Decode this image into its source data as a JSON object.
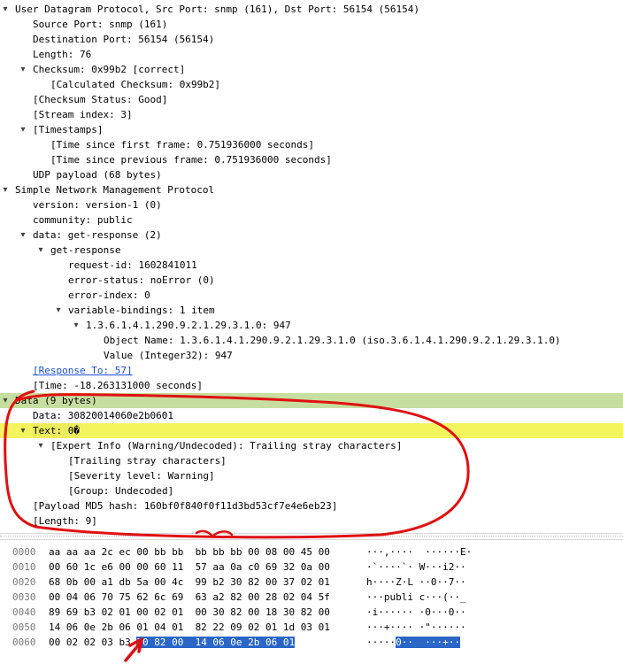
{
  "packet_tree": [
    {
      "indent": 0,
      "arrow": "▾",
      "text": "User Datagram Protocol, Src Port: snmp (161), Dst Port: 56154 (56154)"
    },
    {
      "indent": 1,
      "arrow": "",
      "text": "Source Port: snmp (161)"
    },
    {
      "indent": 1,
      "arrow": "",
      "text": "Destination Port: 56154 (56154)"
    },
    {
      "indent": 1,
      "arrow": "",
      "text": "Length: 76"
    },
    {
      "indent": 1,
      "arrow": "▾",
      "text": "Checksum: 0x99b2 [correct]"
    },
    {
      "indent": 2,
      "arrow": "",
      "text": "[Calculated Checksum: 0x99b2]"
    },
    {
      "indent": 1,
      "arrow": "",
      "text": "[Checksum Status: Good]"
    },
    {
      "indent": 1,
      "arrow": "",
      "text": "[Stream index: 3]"
    },
    {
      "indent": 1,
      "arrow": "▾",
      "text": "[Timestamps]"
    },
    {
      "indent": 2,
      "arrow": "",
      "text": "[Time since first frame: 0.751936000 seconds]"
    },
    {
      "indent": 2,
      "arrow": "",
      "text": "[Time since previous frame: 0.751936000 seconds]"
    },
    {
      "indent": 1,
      "arrow": "",
      "text": "UDP payload (68 bytes)"
    },
    {
      "indent": 0,
      "arrow": "▾",
      "text": "Simple Network Management Protocol"
    },
    {
      "indent": 1,
      "arrow": "",
      "text": "version: version-1 (0)"
    },
    {
      "indent": 1,
      "arrow": "",
      "text": "community: public"
    },
    {
      "indent": 1,
      "arrow": "▾",
      "text": "data: get-response (2)"
    },
    {
      "indent": 2,
      "arrow": "▾",
      "text": "get-response"
    },
    {
      "indent": 3,
      "arrow": "",
      "text": "request-id: 1602841011"
    },
    {
      "indent": 3,
      "arrow": "",
      "text": "error-status: noError (0)"
    },
    {
      "indent": 3,
      "arrow": "",
      "text": "error-index: 0"
    },
    {
      "indent": 3,
      "arrow": "▾",
      "text": "variable-bindings: 1 item"
    },
    {
      "indent": 4,
      "arrow": "▾",
      "text": "1.3.6.1.4.1.290.9.2.1.29.3.1.0: 947"
    },
    {
      "indent": 5,
      "arrow": "",
      "text": "Object Name: 1.3.6.1.4.1.290.9.2.1.29.3.1.0 (iso.3.6.1.4.1.290.9.2.1.29.3.1.0)"
    },
    {
      "indent": 5,
      "arrow": "",
      "text": "Value (Integer32): 947"
    },
    {
      "indent": 1,
      "arrow": "",
      "text": "[Response To: 57]",
      "link": true
    },
    {
      "indent": 1,
      "arrow": "",
      "text": "[Time: -18.263131000 seconds]"
    },
    {
      "indent": 0,
      "arrow": "▾",
      "text": "Data (9 bytes)",
      "hl": "green"
    },
    {
      "indent": 1,
      "arrow": "",
      "text": "Data: 30820014060e2b0601"
    },
    {
      "indent": 1,
      "arrow": "▾",
      "text": "Text: 0�",
      "hl": "yellow"
    },
    {
      "indent": 2,
      "arrow": "▾",
      "text": "[Expert Info (Warning/Undecoded): Trailing stray characters]"
    },
    {
      "indent": 3,
      "arrow": "",
      "text": "[Trailing stray characters]"
    },
    {
      "indent": 3,
      "arrow": "",
      "text": "[Severity level: Warning]"
    },
    {
      "indent": 3,
      "arrow": "",
      "text": "[Group: Undecoded]"
    },
    {
      "indent": 1,
      "arrow": "",
      "text": "[Payload MD5 hash: 160bf0f840f0f11d3bd53cf7e4e6eb23]"
    },
    {
      "indent": 1,
      "arrow": "",
      "text": "[Length: 9]"
    }
  ],
  "hex_rows": [
    {
      "offset": "0000",
      "hex": "aa aa aa 2c ec 00 bb bb  bb bb bb 00 08 00 45 00",
      "ascii": "···,····  ······E·"
    },
    {
      "offset": "0010",
      "hex": "00 60 1c e6 00 00 60 11  57 aa 0a c0 69 32 0a 00",
      "ascii": "·`····`· W···i2··"
    },
    {
      "offset": "0020",
      "hex": "68 0b 00 a1 db 5a 00 4c  99 b2 30 82 00 37 02 01",
      "ascii": "h····Z·L ··0··7··"
    },
    {
      "offset": "0030",
      "hex": "00 04 06 70 75 62 6c 69  63 a2 82 00 28 02 04 5f",
      "ascii": "···publi c···(··_"
    },
    {
      "offset": "0040",
      "hex": "89 69 b3 02 01 00 02 01  00 30 82 00 18 30 82 00",
      "ascii": "·i······ ·0···0··"
    },
    {
      "offset": "0050",
      "hex": "14 06 0e 2b 06 01 04 01  82 22 09 02 01 1d 03 01",
      "ascii": "···+···· ·\"······"
    },
    {
      "offset": "0060",
      "hex_plain": "00 02 02 03 b3 ",
      "hex_sel": "30 82 00  14 06 0e 2b 06 01",
      "ascii_plain": "·····",
      "ascii_sel": "0··  ···+··"
    }
  ],
  "colors": {
    "selection_green": "#c6dea0",
    "text_yellow": "#f4f45e",
    "byte_selection": "#2a66c8",
    "annotation_red": "#e01010"
  }
}
